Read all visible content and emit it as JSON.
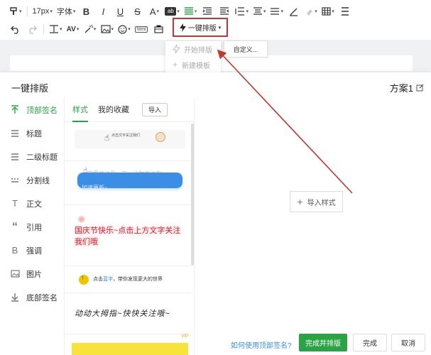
{
  "toolbar": {
    "font_size": "17px",
    "font_family_label": "字体",
    "format_buttons": [
      "B",
      "I",
      "U",
      "S",
      "A"
    ],
    "highlight_label": "ab",
    "html_label": "html",
    "onekey_label": "一键排版"
  },
  "dropdown": {
    "items": [
      "开始排版",
      "新建模板"
    ],
    "custom_label": "自定义..."
  },
  "panel": {
    "title": "一键排版",
    "scheme": "方案1",
    "nav": [
      {
        "label": "顶部签名",
        "icon": "arrow-up-icon"
      },
      {
        "label": "标题",
        "icon": "lines-icon"
      },
      {
        "label": "二级标题",
        "icon": "lines-icon"
      },
      {
        "label": "分割线",
        "icon": "divider-icon"
      },
      {
        "label": "正文",
        "icon": "text-t-icon"
      },
      {
        "label": "引用",
        "icon": "quote-icon"
      },
      {
        "label": "强调",
        "icon": "b-icon"
      },
      {
        "label": "图片",
        "icon": "image-icon"
      },
      {
        "label": "底部签名",
        "icon": "arrow-down-icon"
      }
    ],
    "tabs": [
      "样式",
      "我的收藏"
    ],
    "import_label": "导入",
    "templates": {
      "t1_text": "点击文字关注我们",
      "t2_text": "一定要关注号一下，让你关注的",
      "t2_text2": "加速更新~",
      "t3_text": "国庆节快乐~点击上方文字关注我们哦",
      "t4_text_a": "点击",
      "t4_text_link": "蓝字",
      "t4_text_b": "，带你发现更大的世界",
      "t5_text": "动动大拇指~快快关注哦~",
      "t6_vip": "VIP"
    },
    "center_import": "导入样式",
    "help_link": "如何使用顶部签名?",
    "primary_button": "完成并排版",
    "done_button": "完成",
    "cancel_button": "取消"
  },
  "colors": {
    "accent_green": "#2aa344",
    "highlight_red": "#c8333a",
    "link_blue": "#3a8ee6"
  }
}
